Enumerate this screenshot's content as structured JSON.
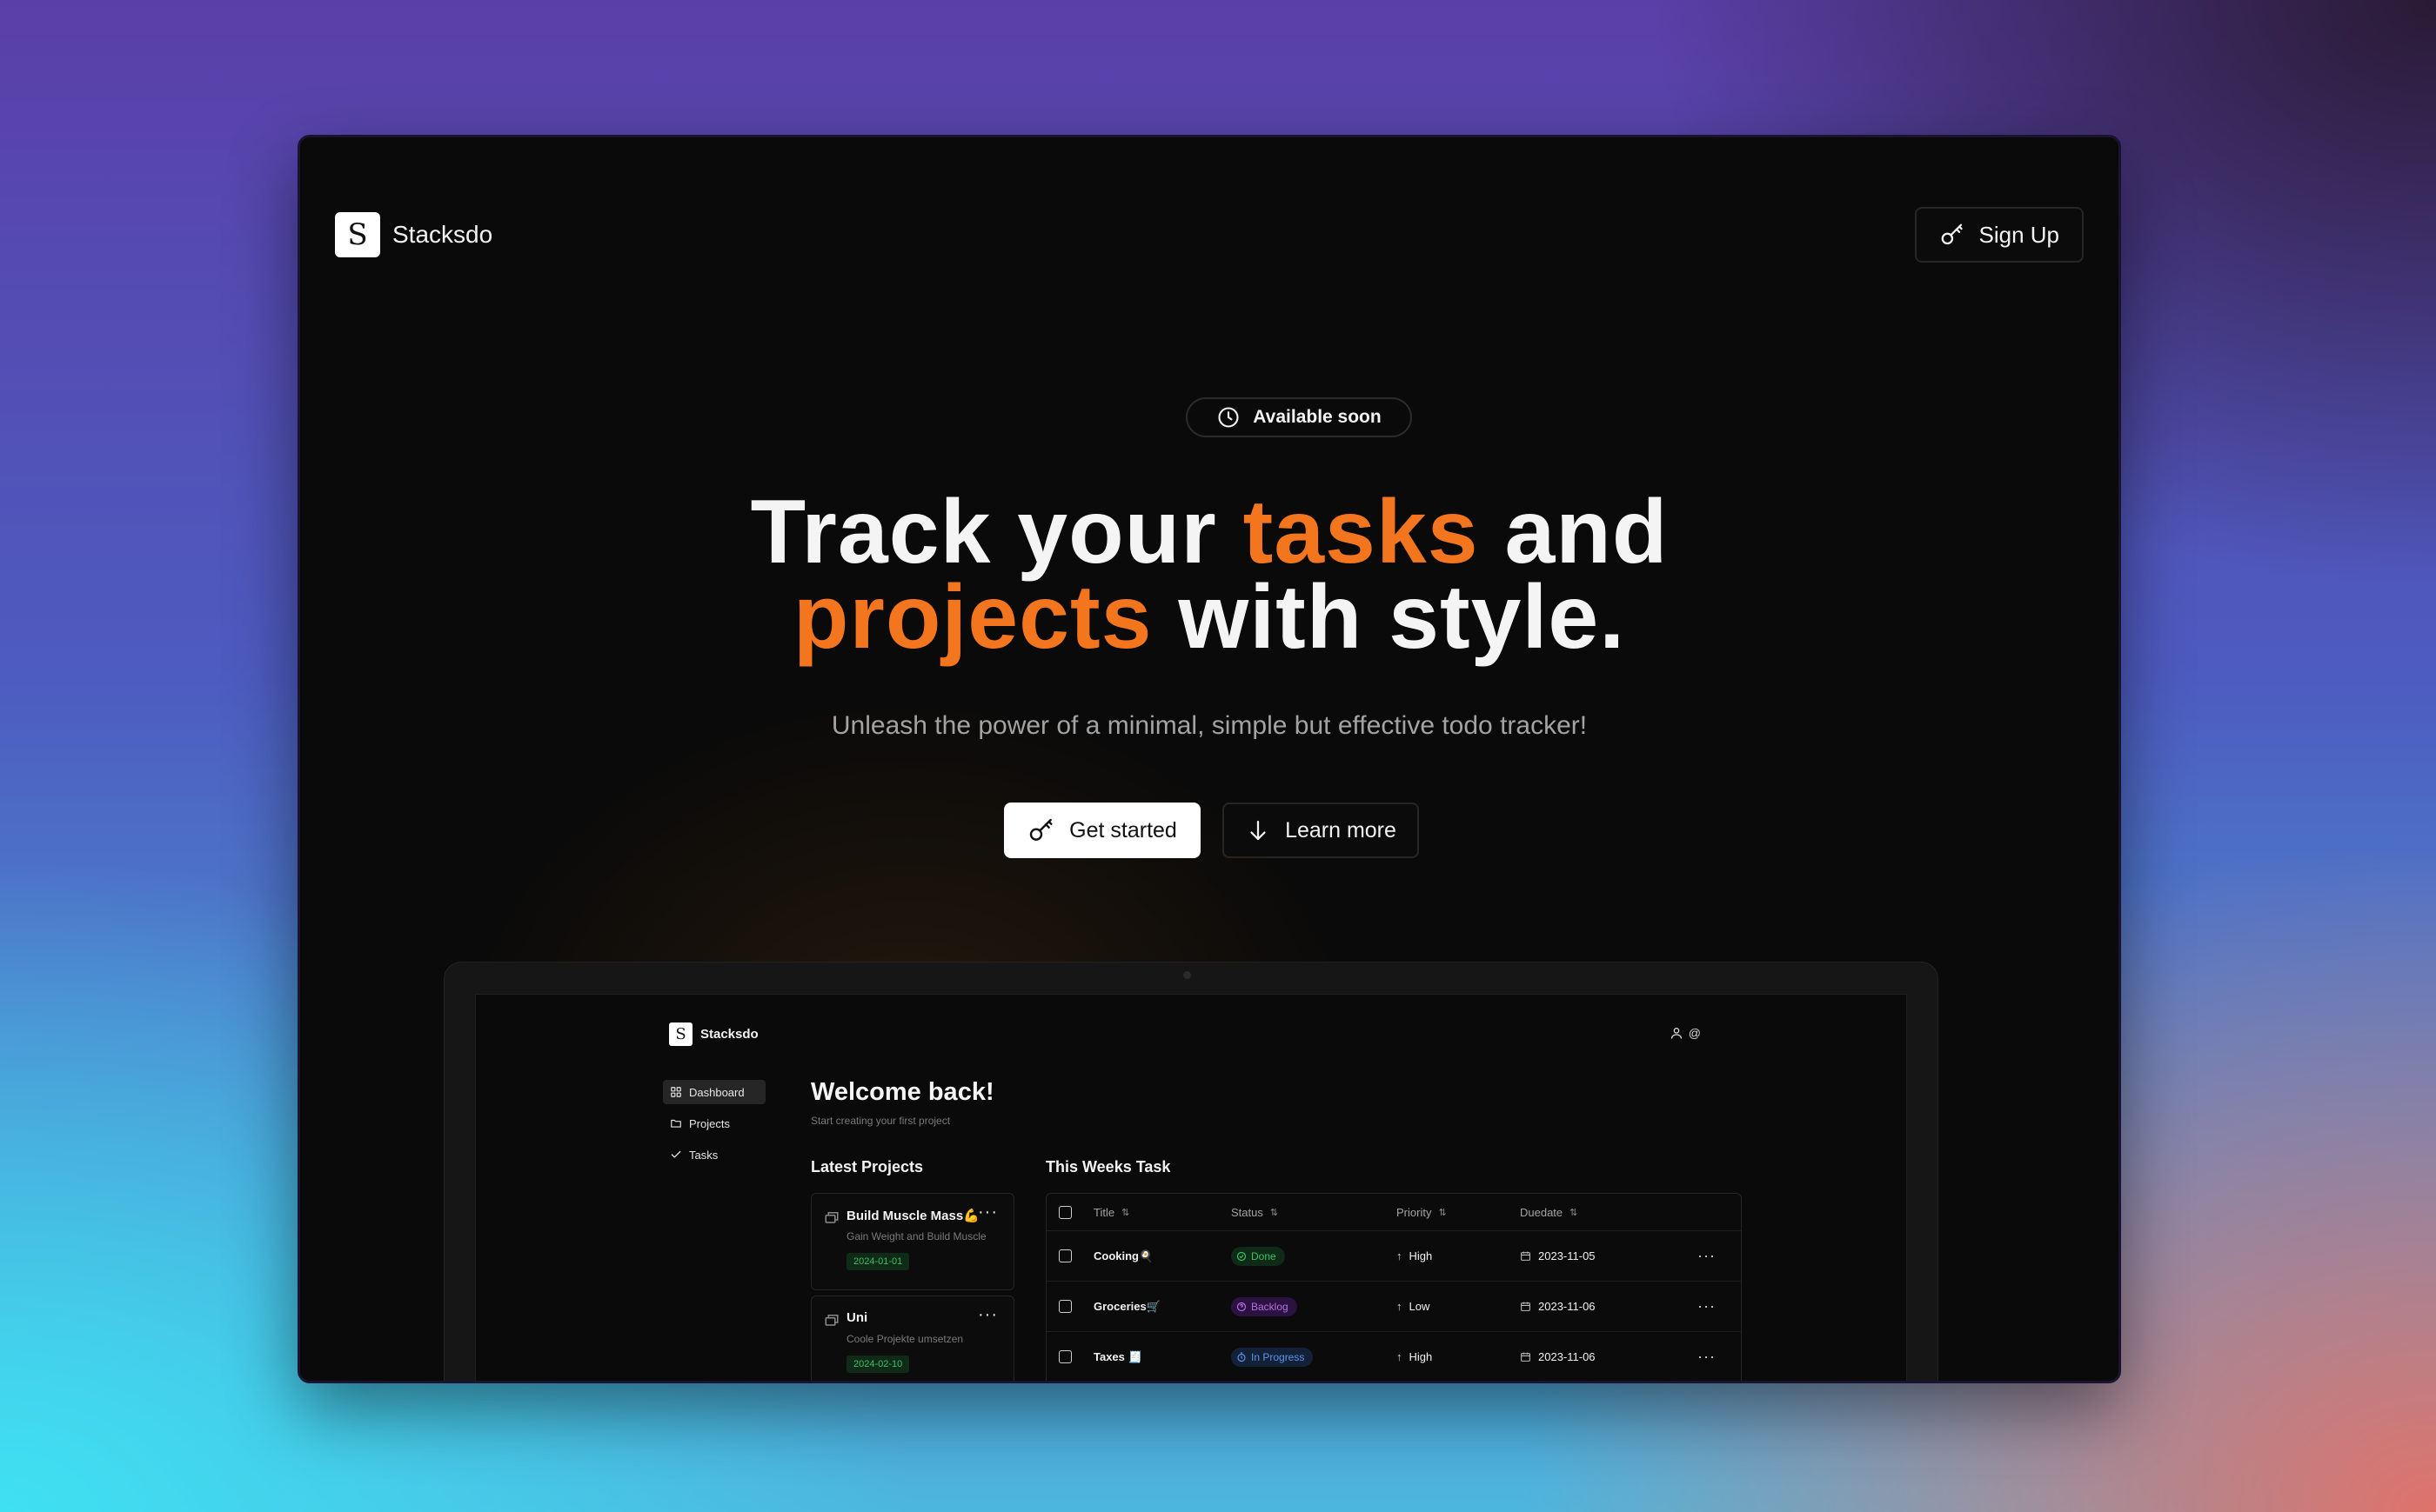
{
  "header": {
    "brand_letter": "S",
    "brand_name": "Stacksdo",
    "signup_label": "Sign Up"
  },
  "hero": {
    "badge_label": "Available soon",
    "headline_line1_a": "Track your ",
    "headline_line1_accent": "tasks",
    "headline_line1_b": " and",
    "headline_line2_accent": "projects",
    "headline_line2_b": " with style.",
    "subtitle": "Unleash the power of a minimal, simple but effective todo tracker!",
    "cta_primary": "Get started",
    "cta_secondary": "Learn more"
  },
  "app": {
    "brand_letter": "S",
    "brand_name": "Stacksdo",
    "user_handle": "@",
    "sidebar": [
      {
        "label": "Dashboard",
        "icon": "grid-icon",
        "active": true
      },
      {
        "label": "Projects",
        "icon": "folder-icon",
        "active": false
      },
      {
        "label": "Tasks",
        "icon": "check-icon",
        "active": false
      }
    ],
    "welcome_title": "Welcome back!",
    "welcome_sub": "Start creating your first project",
    "latest_projects_title": "Latest Projects",
    "this_weeks_title": "This Weeks Task",
    "projects": [
      {
        "title": "Build Muscle Mass💪",
        "desc": "Gain Weight and Build Muscle",
        "date": "2024-01-01"
      },
      {
        "title": "Uni",
        "desc": "Coole Projekte umsetzen",
        "date": "2024-02-10"
      }
    ],
    "table": {
      "headers": {
        "title": "Title",
        "status": "Status",
        "priority": "Priority",
        "duedate": "Duedate"
      },
      "rows": [
        {
          "title": "Cooking🍳",
          "status": "Done",
          "status_kind": "done",
          "priority": "High",
          "duedate": "2023-11-05"
        },
        {
          "title": "Groceries🛒",
          "status": "Backlog",
          "status_kind": "backlog",
          "priority": "Low",
          "duedate": "2023-11-06"
        },
        {
          "title": "Taxes 🧾",
          "status": "In Progress",
          "status_kind": "progress",
          "priority": "High",
          "duedate": "2023-11-06"
        }
      ]
    }
  },
  "colors": {
    "accent": "#f3761f",
    "background": "#0a0a0a",
    "status_done": "#3fbf66",
    "status_backlog": "#b46fe6",
    "status_progress": "#5f92e6"
  }
}
